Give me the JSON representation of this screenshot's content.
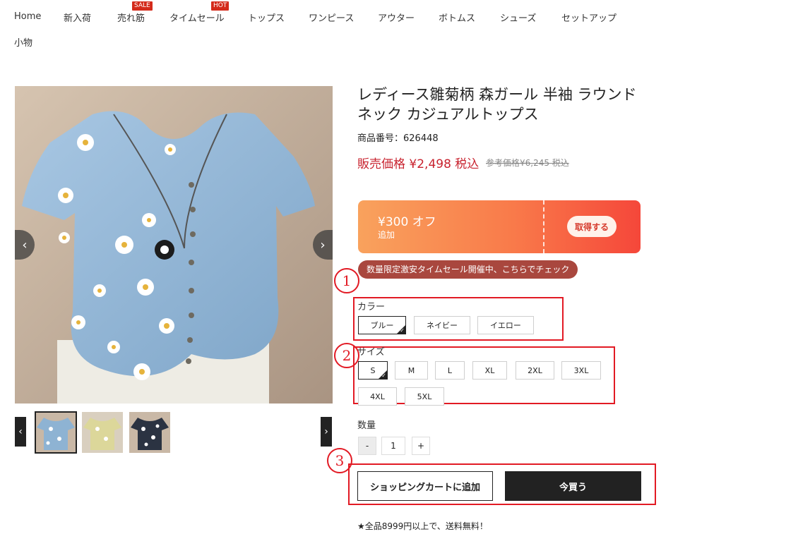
{
  "nav": {
    "items": [
      {
        "label": "Home"
      },
      {
        "label": "新入荷"
      },
      {
        "label": "売れ筋",
        "badge": "SALE"
      },
      {
        "label": "タイムセール",
        "badge": "HOT"
      },
      {
        "label": "トップス"
      },
      {
        "label": "ワンピース"
      },
      {
        "label": "アウター"
      },
      {
        "label": "ボトムス"
      },
      {
        "label": "シューズ"
      },
      {
        "label": "セットアップ"
      },
      {
        "label": "小物"
      }
    ]
  },
  "gallery": {
    "prev_icon": "chevron-left-icon",
    "next_icon": "chevron-right-icon",
    "thumbs": [
      {
        "color": "#8eb3d3",
        "state": "active"
      },
      {
        "color": "#dcd79a"
      },
      {
        "color": "#2b3342"
      }
    ]
  },
  "product": {
    "title": "レディース雛菊柄 森ガール 半袖 ラウンドネック カジュアルトップス",
    "sku": "商品番号：626448",
    "sale_price": "販売価格 ¥2,498 税込",
    "ref_price": "参考価格¥6,245 税込"
  },
  "coupon": {
    "amount": "¥300 オフ",
    "sub": "追加",
    "button": "取得する"
  },
  "timesale_banner": "数量限定激安タイムセール開催中、こちらでチェック",
  "annotations": [
    "1",
    "2",
    "3"
  ],
  "color": {
    "label": "カラー",
    "options": [
      "ブルー",
      "ネイビー",
      "イエロー"
    ],
    "selected": "ブルー"
  },
  "size": {
    "label": "サイズ",
    "options": [
      "S",
      "M",
      "L",
      "XL",
      "2XL",
      "3XL",
      "4XL",
      "5XL"
    ],
    "selected": "S"
  },
  "quantity": {
    "label": "数量",
    "minus": "-",
    "value": "1",
    "plus": "+"
  },
  "actions": {
    "cart": "ショッピングカートに追加",
    "buy": "今買う"
  },
  "shipping_note": "★全品8999円以上で、送料無料！",
  "colors": {
    "accent_red": "#c8222e",
    "annotation_red": "#e21a24",
    "button_dark": "#222222"
  }
}
